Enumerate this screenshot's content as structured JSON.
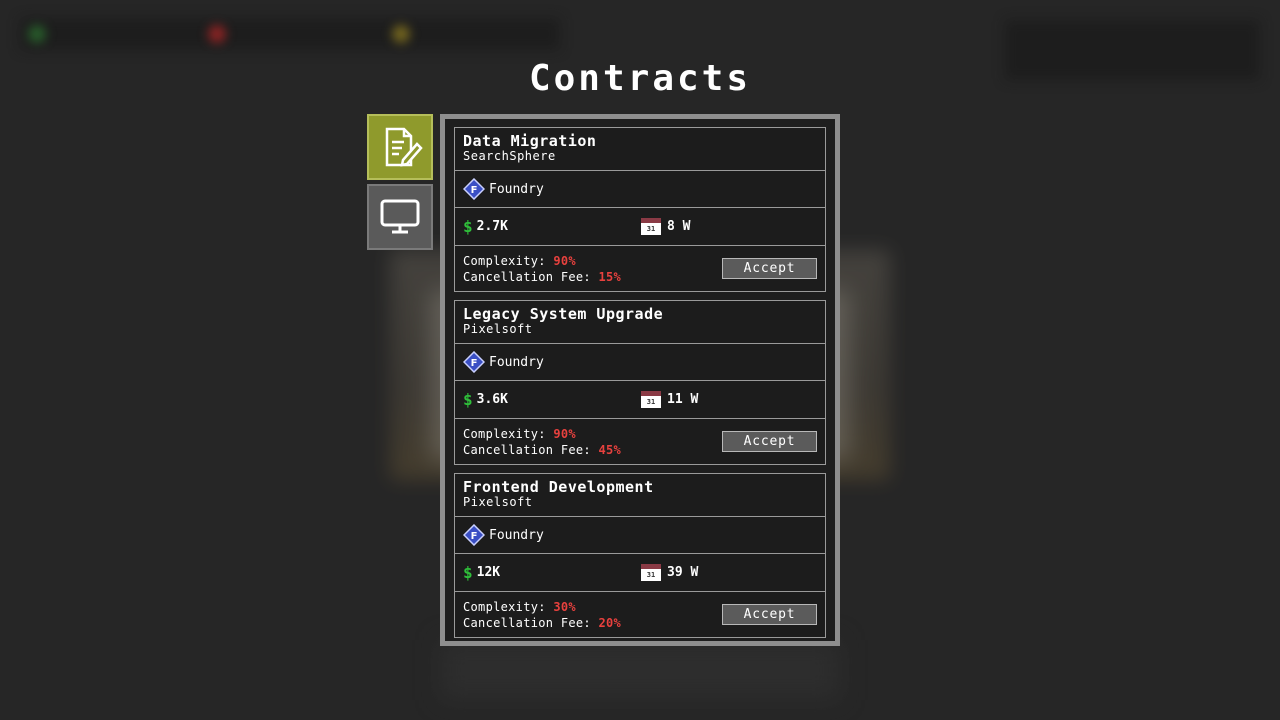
{
  "title": "Contracts",
  "tabs": [
    {
      "name": "contracts",
      "icon": "document-pen-icon",
      "active": true
    },
    {
      "name": "computer",
      "icon": "monitor-icon",
      "active": false
    }
  ],
  "contracts": [
    {
      "title": "Data Migration",
      "client": "SearchSphere",
      "type": "Foundry",
      "type_badge": "F",
      "pay": "2.7K",
      "duration": "8 W",
      "calendar_day": "31",
      "complexity_label": "Complexity:",
      "complexity": "90%",
      "fee_label": "Cancellation Fee:",
      "fee": "15%",
      "accept_label": "Accept"
    },
    {
      "title": "Legacy System Upgrade",
      "client": "Pixelsoft",
      "type": "Foundry",
      "type_badge": "F",
      "pay": "3.6K",
      "duration": "11 W",
      "calendar_day": "31",
      "complexity_label": "Complexity:",
      "complexity": "90%",
      "fee_label": "Cancellation Fee:",
      "fee": "45%",
      "accept_label": "Accept"
    },
    {
      "title": "Frontend Development",
      "client": "Pixelsoft",
      "type": "Foundry",
      "type_badge": "F",
      "pay": "12K",
      "duration": "39 W",
      "calendar_day": "31",
      "complexity_label": "Complexity:",
      "complexity": "30%",
      "fee_label": "Cancellation Fee:",
      "fee": "20%",
      "accept_label": "Accept"
    }
  ],
  "colors": {
    "accent_tab": "#8f9a2c",
    "money": "#2fbf3a",
    "warning": "#e8413e",
    "badge": "#3a4fc4"
  }
}
